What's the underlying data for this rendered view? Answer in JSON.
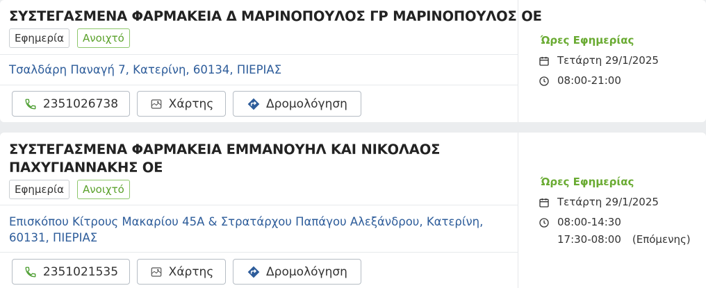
{
  "pharmacies": [
    {
      "title_lines": [
        "ΣΥΣΤΕΓΑΣΜΕΝΑ ΦΑΡΜΑΚΕΙΑ Δ ΜΑΡΙΝΟΠΟΥΛΟΣ ΓΡ ΜΑΡΙΝΟΠΟΥΛΟΣ ΟΕ"
      ],
      "badge_duty": "Εφημερία",
      "badge_open": "Ανοιχτό",
      "address_lines": [
        "Τσαλδάρη Παναγή 7, Κατερίνη, 60134, ΠΙΕΡΙΑΣ"
      ],
      "phone": "2351026738",
      "map_label": "Χάρτης",
      "route_label": "Δρομολόγηση",
      "hours_title": "Ώρες Εφημερίας",
      "date": "Τετάρτη 29/1/2025",
      "time_lines": [
        {
          "time": "08:00-21:00",
          "note": ""
        }
      ]
    },
    {
      "title_lines": [
        "ΣΥΣΤΕΓΑΣΜΕΝΑ ΦΑΡΜΑΚΕΙΑ ΕΜΜΑΝΟΥΗΛ ΚΑΙ ΝΙΚΟΛΑΟΣ",
        "ΠΑΧΥΓΙΑΝΝΑΚΗΣ ΟΕ"
      ],
      "badge_duty": "Εφημερία",
      "badge_open": "Ανοιχτό",
      "address_lines": [
        "Επισκόπου Κίτρους Μακαρίου 45Α & Στρατάρχου Παπάγου Αλεξάνδρου, Κατερίνη,",
        "60131, ΠΙΕΡΙΑΣ"
      ],
      "phone": "2351021535",
      "map_label": "Χάρτης",
      "route_label": "Δρομολόγηση",
      "hours_title": "Ώρες Εφημερίας",
      "date": "Τετάρτη 29/1/2025",
      "time_lines": [
        {
          "time": "08:00-14:30",
          "note": ""
        },
        {
          "time": "17:30-08:00",
          "note": "(Επόμενης)"
        }
      ]
    }
  ],
  "colors": {
    "accent_green": "#6aab33",
    "link_blue": "#2d5c9a",
    "phone_icon": "#4a9c2e",
    "route_icon": "#2d5c9a"
  },
  "icons": [
    "phone-icon",
    "map-icon",
    "route-icon",
    "calendar-icon",
    "clock-icon"
  ]
}
